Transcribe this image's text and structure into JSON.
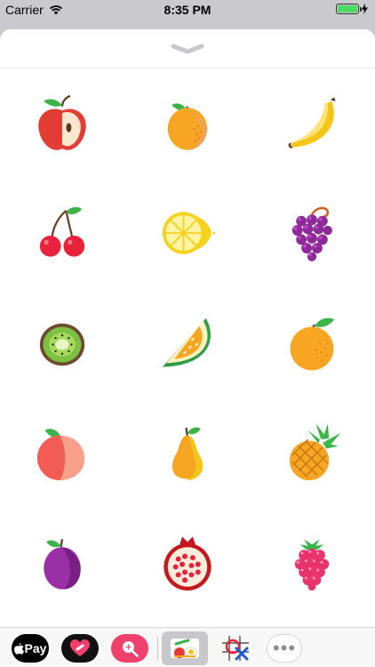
{
  "status_bar": {
    "carrier": "Carrier",
    "time": "8:35 PM",
    "battery_level": 1.0
  },
  "stickers": [
    {
      "name": "apple"
    },
    {
      "name": "apricot"
    },
    {
      "name": "banana"
    },
    {
      "name": "cherries"
    },
    {
      "name": "lemon"
    },
    {
      "name": "grapes"
    },
    {
      "name": "kiwi"
    },
    {
      "name": "melon"
    },
    {
      "name": "orange"
    },
    {
      "name": "peach"
    },
    {
      "name": "pear"
    },
    {
      "name": "pineapple"
    },
    {
      "name": "plum"
    },
    {
      "name": "pomegranate"
    },
    {
      "name": "raspberry"
    }
  ],
  "app_tray": {
    "apple_pay_label": "Pay",
    "apps": [
      "apple-pay",
      "heart-app",
      "search-app",
      "fruit-stickers-app",
      "crossword-app",
      "more-apps"
    ],
    "selected": "fruit-stickers-app",
    "more_label": "•••"
  },
  "colors": {
    "accent_pink": "#f2406e",
    "battery_green": "#4cd964",
    "tray_background": "#f7f7f8"
  }
}
